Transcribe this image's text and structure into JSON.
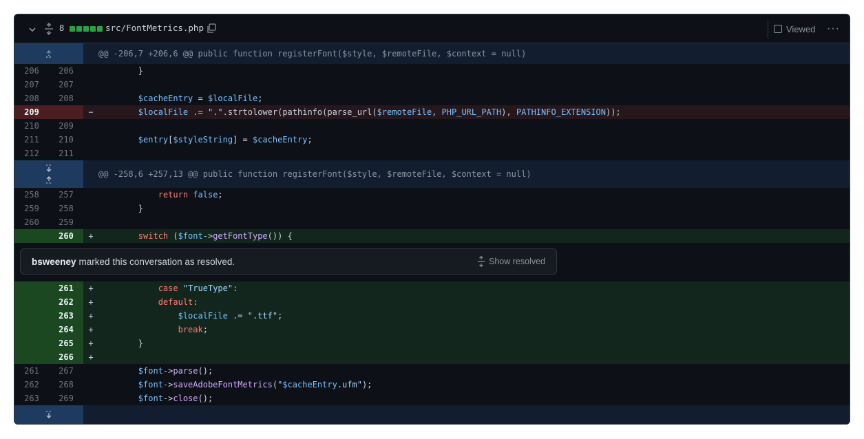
{
  "file_header": {
    "change_count": "8",
    "path": "src/FontMetrics.php",
    "viewed_label": "Viewed",
    "diffstat_blocks": 5,
    "icons": {
      "collapse": "chevron-down-icon",
      "expand": "unfold-icon",
      "copy": "copy-icon",
      "more": "kebab-horizontal-icon"
    }
  },
  "hunks": [
    {
      "header": "@@ -206,7 +206,6 @@ public function registerFont($style, $remoteFile, $context = null)"
    },
    {
      "header": "@@ -258,6 +257,13 @@ public function registerFont($style, $remoteFile, $context = null)"
    }
  ],
  "lines_a": [
    {
      "old": "206",
      "new": "206",
      "sign": "",
      "code": "        }"
    },
    {
      "old": "207",
      "new": "207",
      "sign": "",
      "code": ""
    },
    {
      "old": "208",
      "new": "208",
      "sign": "",
      "code": "        $cacheEntry = $localFile;"
    },
    {
      "old": "209",
      "new": "",
      "sign": "−",
      "code": "        $localFile .= \".\".strtolower(pathinfo(parse_url($remoteFile, PHP_URL_PATH), PATHINFO_EXTENSION));"
    },
    {
      "old": "210",
      "new": "209",
      "sign": "",
      "code": ""
    },
    {
      "old": "211",
      "new": "210",
      "sign": "",
      "code": "        $entry[$styleString] = $cacheEntry;"
    },
    {
      "old": "212",
      "new": "211",
      "sign": "",
      "code": ""
    }
  ],
  "lines_b": [
    {
      "old": "258",
      "new": "257",
      "sign": "",
      "code": "            return false;"
    },
    {
      "old": "259",
      "new": "258",
      "sign": "",
      "code": "        }"
    },
    {
      "old": "260",
      "new": "259",
      "sign": "",
      "code": ""
    },
    {
      "old": "",
      "new": "260",
      "sign": "+",
      "code": "        switch ($font->getFontType()) {"
    }
  ],
  "conversation": {
    "user": "bsweeney",
    "message": "marked this conversation as resolved.",
    "show_resolved": "Show resolved"
  },
  "lines_c": [
    {
      "old": "",
      "new": "261",
      "sign": "+",
      "code": "            case \"TrueType\":"
    },
    {
      "old": "",
      "new": "262",
      "sign": "+",
      "code": "            default:"
    },
    {
      "old": "",
      "new": "263",
      "sign": "+",
      "code": "                $localFile .= \".ttf\";"
    },
    {
      "old": "",
      "new": "264",
      "sign": "+",
      "code": "                break;"
    },
    {
      "old": "",
      "new": "265",
      "sign": "+",
      "code": "        }"
    },
    {
      "old": "",
      "new": "266",
      "sign": "+",
      "code": ""
    },
    {
      "old": "261",
      "new": "267",
      "sign": "",
      "code": "        $font->parse();"
    },
    {
      "old": "262",
      "new": "268",
      "sign": "",
      "code": "        $font->saveAdobeFontMetrics(\"$cacheEntry.ufm\");"
    },
    {
      "old": "263",
      "new": "269",
      "sign": "",
      "code": "        $font->close();"
    }
  ]
}
